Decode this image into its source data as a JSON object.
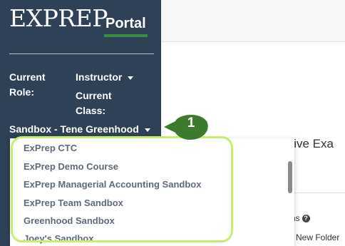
{
  "sidebar": {
    "logo_text": "EXPREP",
    "logo_suffix": "Portal",
    "current_role_label": "Current Role:",
    "current_role_value": "Instructor",
    "current_class_label": "Current Class:",
    "class_selected": "Sandbox - Tene Greenhood"
  },
  "background": {
    "page_title_fragment": "ctive Exa",
    "exams_fragment": "ams",
    "new_folder_fragment": "New Folder"
  },
  "dropdown": {
    "options": [
      "ExPrep CTC",
      "ExPrep Demo Course",
      "ExPrep Managerial Accounting Sandbox",
      "ExPrep Team Sandbox",
      "Greenhood Sandbox",
      "Joey's Sandbox"
    ]
  },
  "annotation": {
    "callout_number": "1",
    "callout_color": "#3b7a2f",
    "highlight_color": "#c7ef6c"
  }
}
